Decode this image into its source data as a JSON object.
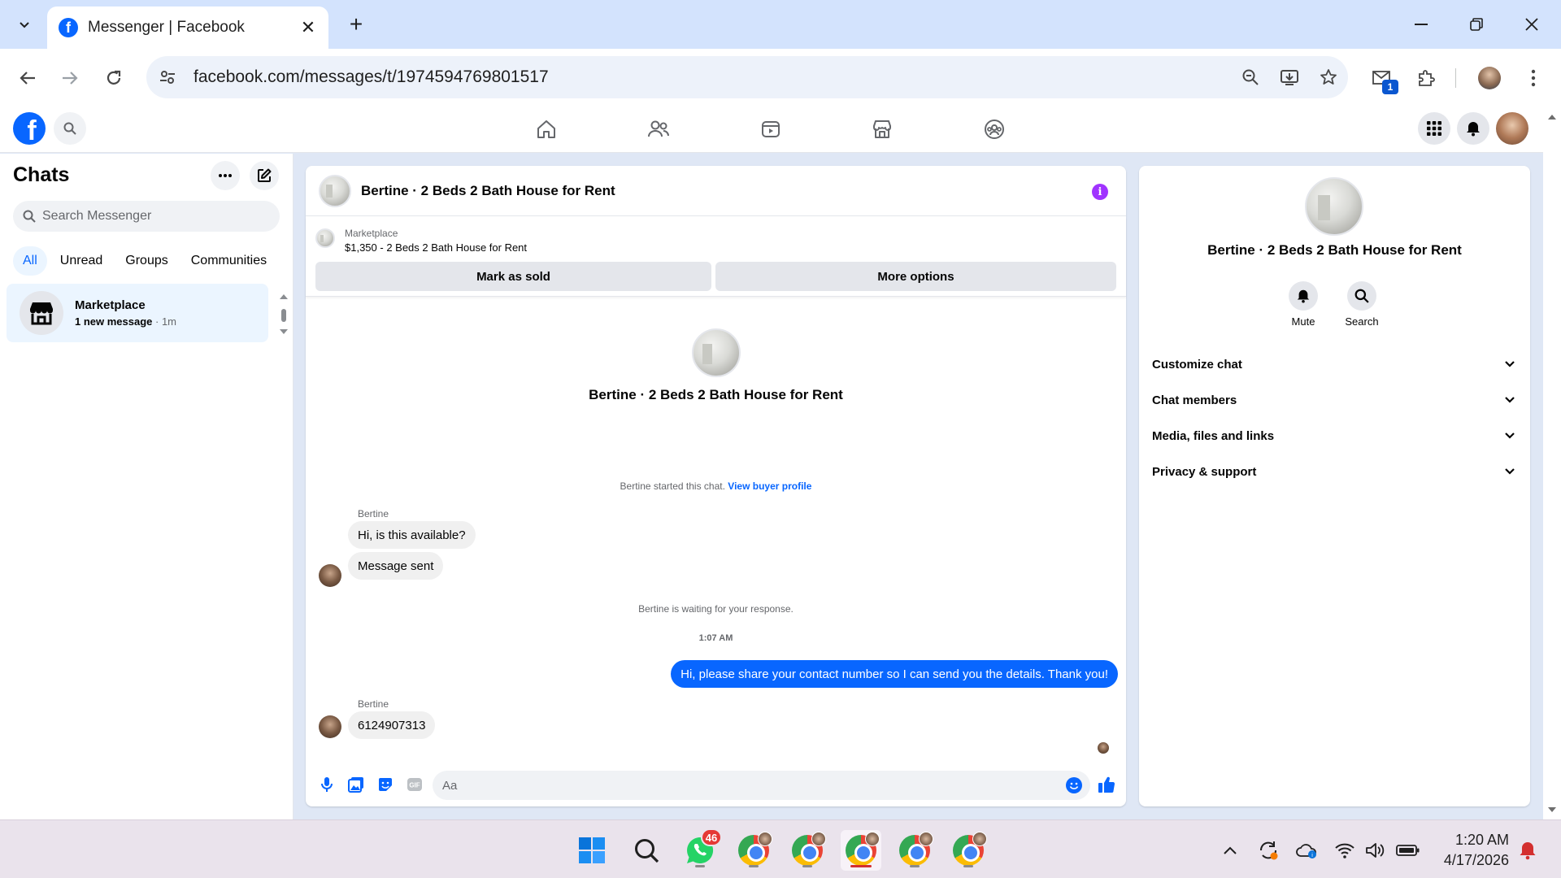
{
  "browser": {
    "tab_title": "Messenger | Facebook",
    "url": "facebook.com/messages/t/1974594769801517",
    "extension_badge": "1"
  },
  "fb_header": {
    "logo_letter": "f"
  },
  "chats": {
    "title": "Chats",
    "search_placeholder": "Search Messenger",
    "filters": [
      "All",
      "Unread",
      "Groups",
      "Communities"
    ],
    "active_filter": "All",
    "items": [
      {
        "name": "Marketplace",
        "subtitle_bold": "1 new message",
        "subtitle_time": " · 1m"
      }
    ]
  },
  "conversation": {
    "title": "Bertine · 2 Beds 2 Bath House for Rent",
    "marketplace_label": "Marketplace",
    "listing": "$1,350 - 2 Beds 2 Bath House for Rent",
    "mark_sold_label": "Mark as sold",
    "more_options_label": "More options",
    "profile_name": "Bertine · 2 Beds 2 Bath House for Rent",
    "started_text": "Bertine started this chat.",
    "view_buyer_profile": "View buyer profile",
    "messages": [
      {
        "sender": "Bertine",
        "text": "Hi, is this available?"
      },
      {
        "text": "Message sent"
      }
    ],
    "waiting_text": "Bertine is waiting for your response.",
    "timestamp": "1:07 AM",
    "outgoing": "Hi, please share your contact number so I can send you the details. Thank you!",
    "reply_sender": "Bertine",
    "reply_text": "6124907313",
    "composer_placeholder": "Aa"
  },
  "details": {
    "name": "Bertine · 2 Beds 2 Bath House for Rent",
    "actions": [
      "Mute",
      "Search"
    ],
    "sections": [
      "Customize chat",
      "Chat members",
      "Media, files and links",
      "Privacy & support"
    ]
  },
  "taskbar": {
    "whatsapp_badge": "46",
    "time": "1:20 AM",
    "date": "4/17/2026"
  },
  "colors": {
    "accent": "#0866ff",
    "info": "#a033ff",
    "taskbar": "#eae3ec"
  }
}
